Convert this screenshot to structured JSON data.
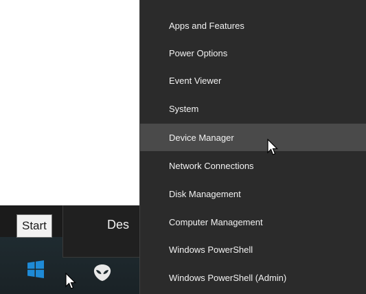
{
  "taskbar": {
    "tooltip_text": "Start",
    "background_panel_label": "Des",
    "start_icon": "windows-logo-icon",
    "pinned_icon": "alien-icon",
    "accent_color": "#1e8ad6"
  },
  "menu": {
    "items": [
      {
        "label": "Apps and Features"
      },
      {
        "label": "Power Options"
      },
      {
        "label": "Event Viewer"
      },
      {
        "label": "System"
      },
      {
        "label": "Device Manager"
      },
      {
        "label": "Network Connections"
      },
      {
        "label": "Disk Management"
      },
      {
        "label": "Computer Management"
      },
      {
        "label": "Windows PowerShell"
      },
      {
        "label": "Windows PowerShell (Admin)"
      }
    ],
    "hovered_item": "Device Manager",
    "background_color": "#2b2b2b",
    "hover_color": "#4a4a4a"
  }
}
